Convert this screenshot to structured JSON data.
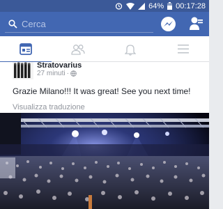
{
  "status_bar": {
    "battery": "64%",
    "time": "00:17:28",
    "icons": [
      "alarm-icon",
      "wifi-icon",
      "signal-icon",
      "battery-icon"
    ]
  },
  "top_bar": {
    "search_placeholder": "Cerca",
    "icons": [
      "search-icon",
      "messenger-icon",
      "friend-requests-icon"
    ]
  },
  "tabs": [
    {
      "name": "news-feed",
      "icon": "news-feed-icon",
      "active": true
    },
    {
      "name": "friends",
      "icon": "friends-icon",
      "active": false
    },
    {
      "name": "notifications",
      "icon": "bell-icon",
      "active": false
    },
    {
      "name": "menu",
      "icon": "menu-icon",
      "active": false
    }
  ],
  "post": {
    "author": "Stratovarius",
    "time": "27 minuti",
    "privacy_icon": "globe-icon",
    "text": "Grazie Milano!!! It was great! See you next time!",
    "translate_label": "Visualizza traduzione",
    "photo": "concert-crowd-photo"
  },
  "colors": {
    "facebook_blue": "#4267b2",
    "status_blue": "#3b5998",
    "feed_bg": "#e9ebee"
  }
}
